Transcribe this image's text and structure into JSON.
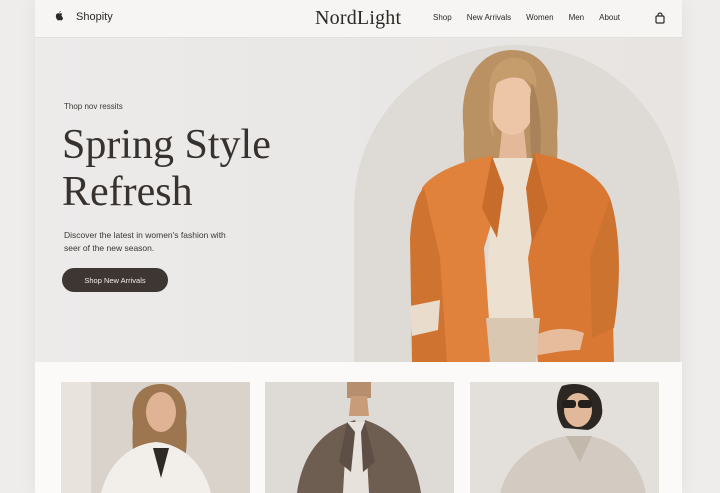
{
  "header": {
    "brand_icon": "apple-icon",
    "brand_name": "Shopity",
    "logo": "NordLight",
    "nav": [
      "Shop",
      "New Arrivals",
      "Women",
      "Men",
      "About"
    ],
    "cart_icon": "shopping-bag-icon"
  },
  "hero": {
    "eyebrow": "Thop nov ressits",
    "headline_line1": "Spring Style",
    "headline_line2": "Refresh",
    "description_line1": "Discover the latest in women's fashion with",
    "description_line2": "seer of the new season.",
    "cta_label": "Shop New Arrivals",
    "model_image": "woman-in-orange-blazer"
  },
  "products": [
    {
      "image": "woman-in-white-shirt"
    },
    {
      "image": "man-in-brown-blazer"
    },
    {
      "image": "woman-with-sunglasses-beige-shirt"
    }
  ],
  "colors": {
    "accent_button": "#3d3632",
    "blazer_orange": "#e0813c",
    "background": "#efedeb"
  }
}
